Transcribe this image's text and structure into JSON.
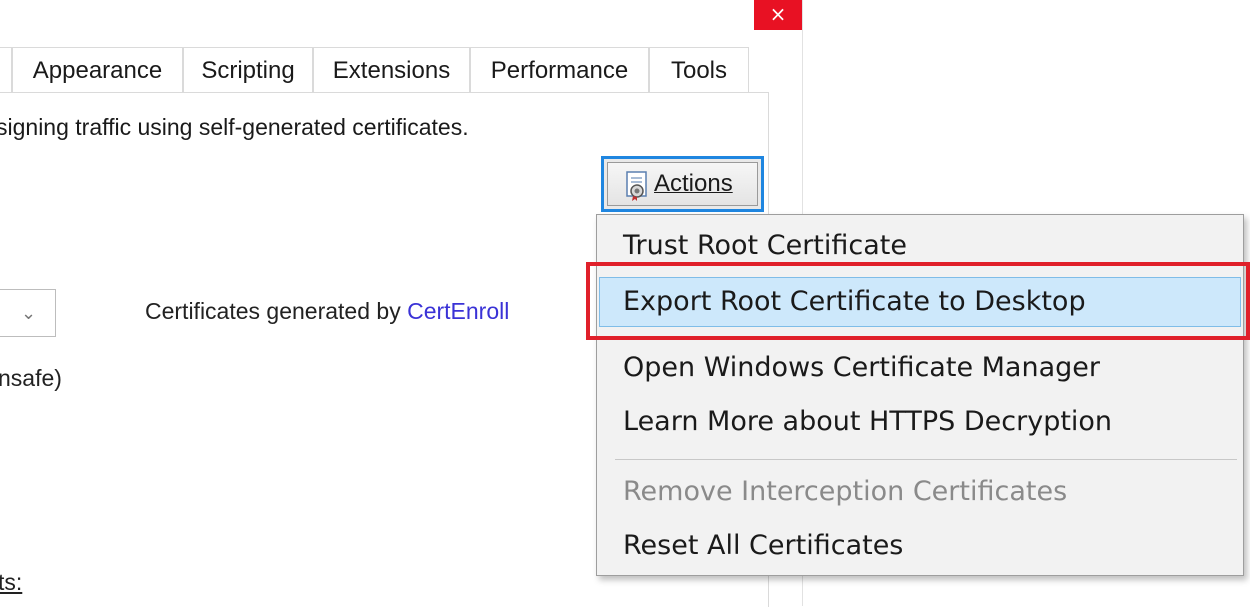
{
  "window": {
    "close_glyph": "×"
  },
  "tabs": [
    {
      "label": "Appearance"
    },
    {
      "label": "Scripting"
    },
    {
      "label": "Extensions"
    },
    {
      "label": "Performance"
    },
    {
      "label": "Tools"
    }
  ],
  "panel": {
    "description": "signing traffic using self-generated certificates.",
    "actions_button": {
      "label": "Actions",
      "icon": "certificate-icon"
    },
    "combo_chevron": "⌄",
    "certs_text": "Certificates generated by ",
    "certs_link": "CertEnroll",
    "unsafe_text": "nsafe)",
    "lists_label": "ts:"
  },
  "menu": {
    "items": [
      {
        "label": "Trust Root Certificate",
        "enabled": true
      },
      {
        "label": "Export Root Certificate to Desktop",
        "enabled": true,
        "highlighted": true
      },
      {
        "label": "Open Windows Certificate Manager",
        "enabled": true
      },
      {
        "label": "Learn More about HTTPS Decryption",
        "enabled": true
      },
      {
        "label": "Remove Interception Certificates",
        "enabled": false
      },
      {
        "label": "Reset All Certificates",
        "enabled": true
      }
    ]
  },
  "colors": {
    "close_button": "#e81123",
    "focus_border": "#1f86e0",
    "menu_highlight": "#cde8fb",
    "annotation_box": "#e0202a",
    "link": "#3a32d6"
  }
}
